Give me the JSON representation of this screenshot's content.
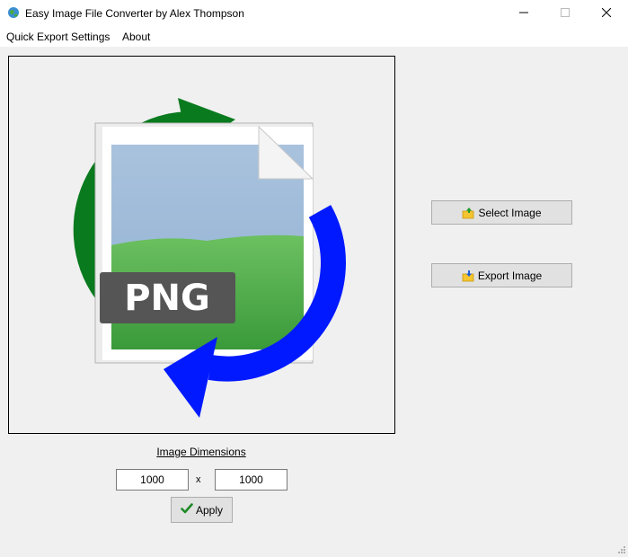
{
  "window": {
    "title": "Easy Image File Converter by Alex Thompson",
    "icon": "globe-icon",
    "controls": [
      "minimize-icon",
      "maximize-icon",
      "close-icon"
    ]
  },
  "menu": {
    "items": [
      "Quick Export Settings",
      "About"
    ]
  },
  "preview": {
    "badge_text": "PNG",
    "arrow_colors": {
      "top": "#0a7a1e",
      "bottom": "#0019ff"
    },
    "badge_color": "#555555"
  },
  "actions": {
    "select_label": "Select Image",
    "select_icon": "folder-up-icon",
    "export_label": "Export Image",
    "export_icon": "folder-down-icon"
  },
  "dimensions": {
    "label": "Image Dimensions",
    "width": "1000",
    "separator": "x",
    "height": "1000",
    "apply_label": "Apply",
    "apply_icon": "checkmark-icon"
  }
}
